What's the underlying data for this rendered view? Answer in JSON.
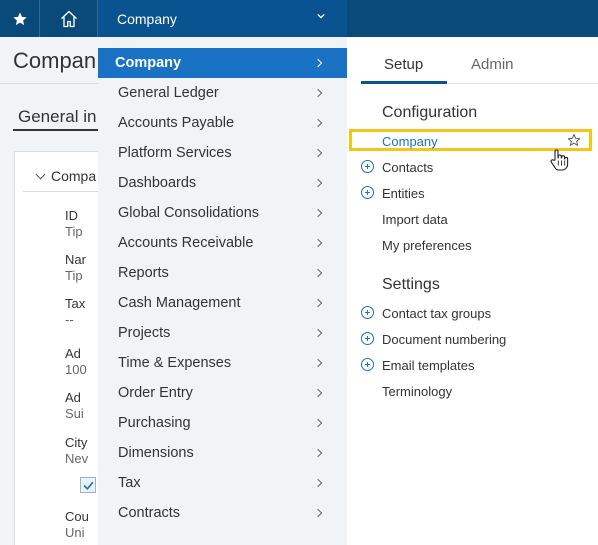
{
  "topbar": {
    "favorites_icon": "star-icon",
    "home_icon": "home-icon",
    "company_label": "Company",
    "company_chevron_icon": "chevron-down-icon"
  },
  "background_page": {
    "title": "Compan",
    "tab": "General in",
    "card_heading": "Compa",
    "fields": [
      {
        "label": "ID",
        "value": "Tip"
      },
      {
        "label": "Nar",
        "value": "Tip"
      },
      {
        "label": "Tax",
        "value": "--"
      },
      {
        "label": "Ad",
        "value": "100"
      },
      {
        "label": "Ad",
        "value": "Sui"
      },
      {
        "label": "City",
        "value": "Nev"
      },
      {
        "label": "Cou",
        "value": "Uni"
      }
    ]
  },
  "menu": {
    "items": [
      {
        "label": "Company",
        "active": true
      },
      {
        "label": "General Ledger"
      },
      {
        "label": "Accounts Payable"
      },
      {
        "label": "Platform Services"
      },
      {
        "label": "Dashboards"
      },
      {
        "label": "Global Consolidations"
      },
      {
        "label": "Accounts Receivable"
      },
      {
        "label": "Reports"
      },
      {
        "label": "Cash Management"
      },
      {
        "label": "Projects"
      },
      {
        "label": "Time & Expenses"
      },
      {
        "label": "Order Entry"
      },
      {
        "label": "Purchasing"
      },
      {
        "label": "Dimensions"
      },
      {
        "label": "Tax"
      },
      {
        "label": "Contracts"
      }
    ]
  },
  "panel": {
    "tabs": {
      "setup": "Setup",
      "admin": "Admin"
    },
    "configuration": {
      "heading": "Configuration",
      "links": [
        "Company",
        "Contacts",
        "Entities",
        "Import data",
        "My preferences"
      ]
    },
    "settings": {
      "heading": "Settings",
      "links": [
        "Contact tax groups",
        "Document numbering",
        "Email templates",
        "Terminology"
      ]
    }
  },
  "colors": {
    "topbar": "#0a4a7a",
    "active_menu": "#1a72c4",
    "highlight": "#f5c518"
  }
}
